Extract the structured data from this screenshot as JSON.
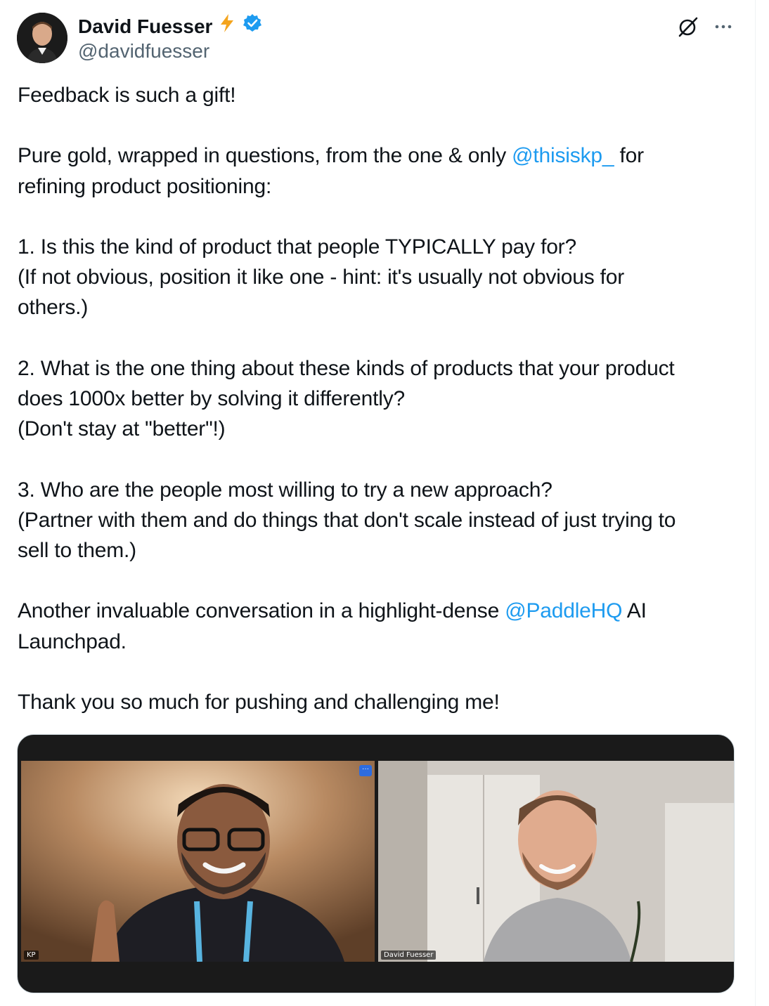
{
  "author": {
    "name": "David Fuesser",
    "handle": "@davidfuesser",
    "emoji_icon": "lightning-bolt-icon",
    "verified_icon": "verified-badge-icon",
    "verified_color": "#1d9bf0"
  },
  "header_actions": {
    "grok_icon": "grok-icon",
    "more_icon": "more-options-icon"
  },
  "tweet": {
    "mention_color": "#1d9bf0",
    "line1": "Feedback is such a gift!",
    "line2_pre": "Pure gold, wrapped in questions, from the one & only ",
    "line2_mention": "@thisiskp_",
    "line2_post": " for",
    "line3": "refining product positioning:",
    "q1_line1": "1. Is this the kind of product that people TYPICALLY pay for?",
    "q1_line2": "(If not obvious, position it like one - hint: it's usually not obvious for",
    "q1_line3": "others.)",
    "q2_line1": "2. What is the one thing about these kinds of products that your product",
    "q2_line2": "does 1000x better by solving it differently?",
    "q2_line3": "(Don't stay at \"better\"!)",
    "q3_line1": "3. Who are the people most willing to try a new approach?",
    "q3_line2": "(Partner with them and do things that don't scale instead of just trying to",
    "q3_line3": "sell to them.)",
    "closing_pre": "Another invaluable conversation in a highlight-dense ",
    "closing_mention": "@PaddleHQ",
    "closing_post": " AI",
    "closing_line2": "Launchpad.",
    "thanks": "Thank you so much for pushing and challenging me!"
  },
  "media": {
    "left_tile_label": "KP",
    "right_tile_label": "David Fuesser",
    "tile_menu_glyph": "···"
  }
}
